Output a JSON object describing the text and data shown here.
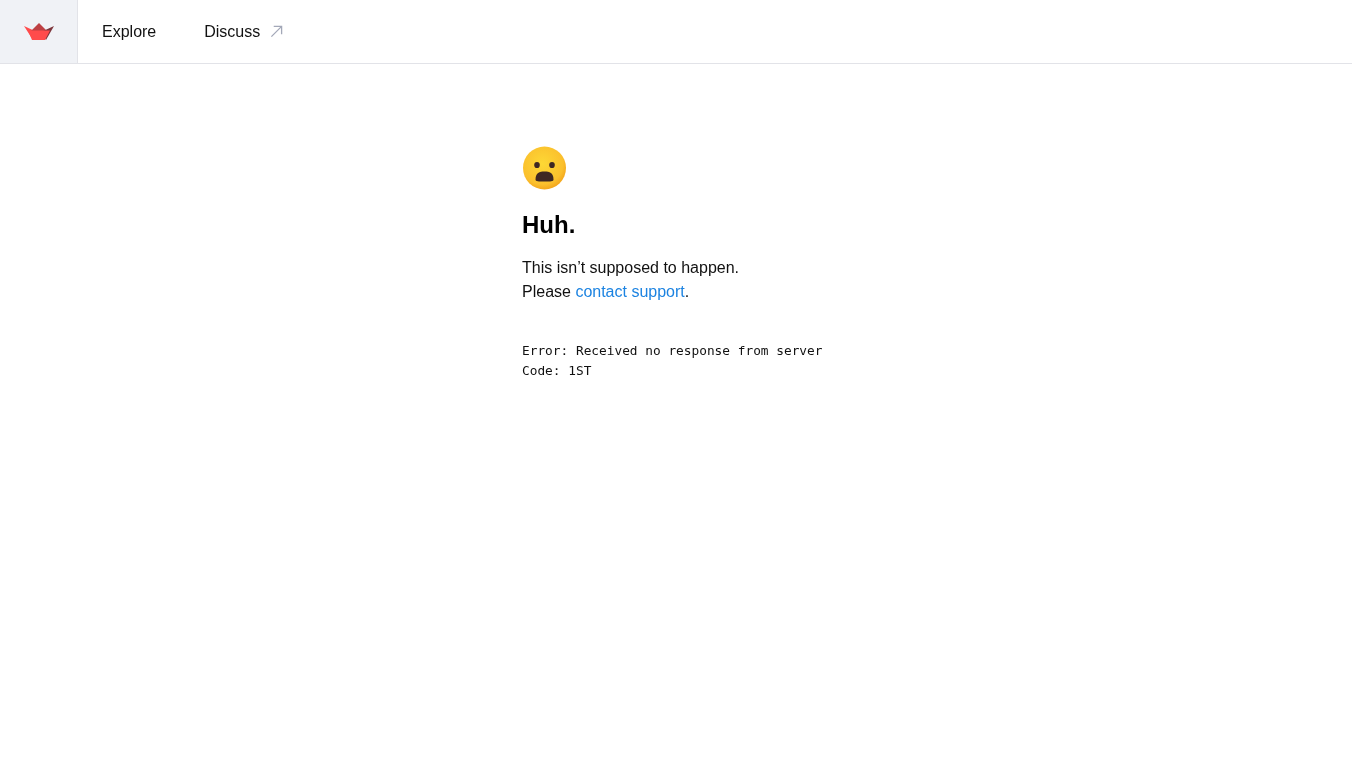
{
  "nav": {
    "links": [
      {
        "label": "Explore",
        "external": false
      },
      {
        "label": "Discuss",
        "external": true
      }
    ]
  },
  "error_page": {
    "heading": "Huh.",
    "message": "This isn’t supposed to happen.",
    "support_prompt": {
      "before": "Please ",
      "link": "contact support",
      "after": "."
    },
    "details": [
      "Error: Received no response from server",
      "Code: 1ST"
    ]
  }
}
